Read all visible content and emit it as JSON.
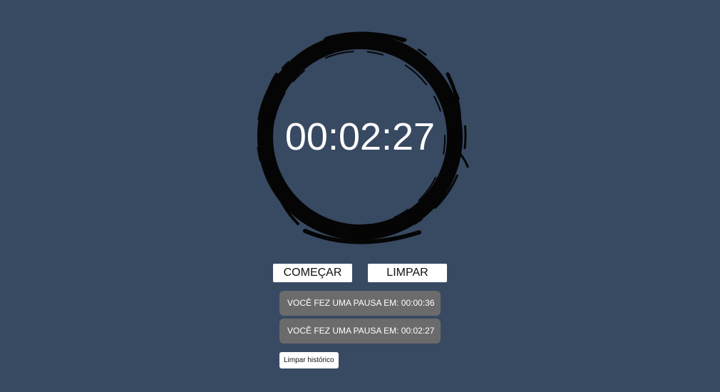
{
  "timer": {
    "display": "00:02:27"
  },
  "controls": {
    "start_label": "COMEÇAR",
    "clear_label": "LIMPAR"
  },
  "history": {
    "items": [
      "VOCÊ FEZ UMA PAUSA EM: 00:00:36",
      "VOCÊ FEZ UMA PAUSA EM: 00:02:27"
    ],
    "clear_label": "Limpar histórico"
  },
  "colors": {
    "background": "#384962",
    "ring": "#050505",
    "history_item": "#6b6b6b",
    "button": "#ffffff"
  },
  "icons": {
    "ring": "ink-brush-circle"
  }
}
